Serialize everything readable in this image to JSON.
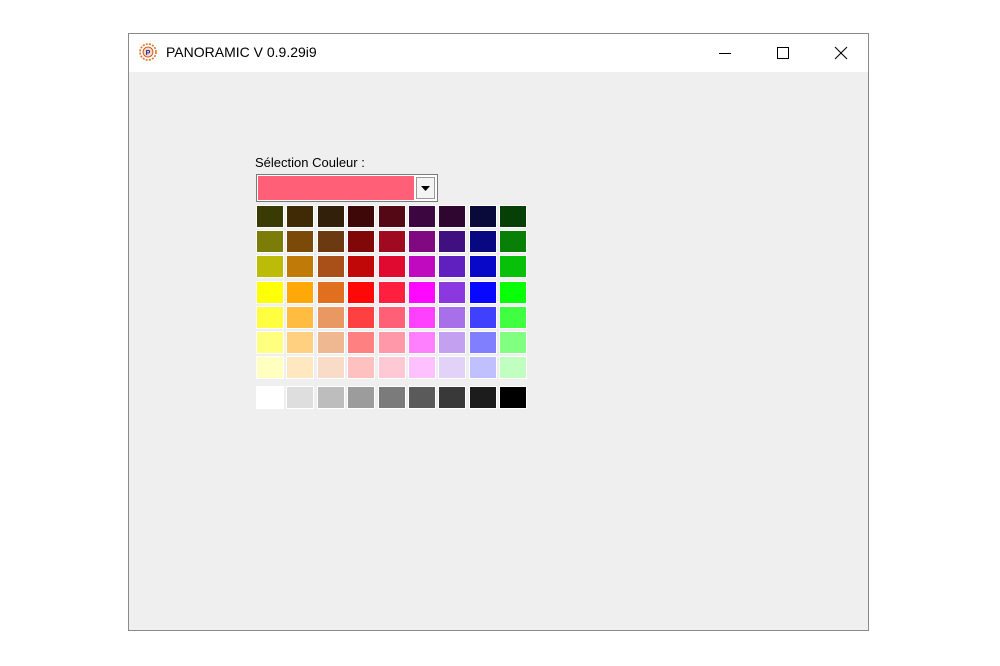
{
  "window": {
    "title": "PANORAMIC V 0.9.29i9",
    "icon": "panoramic-app-icon",
    "controls": [
      "minimize-icon",
      "maximize-icon",
      "close-icon"
    ]
  },
  "form": {
    "label": "Sélection Couleur :",
    "selected_color": "#ff6078",
    "dropdown_icon": "chevron-down-icon"
  },
  "palette": {
    "rows": [
      [
        "#3a3a05",
        "#3f2a05",
        "#33200a",
        "#3e0808",
        "#540816",
        "#3c0640",
        "#2e0630",
        "#0a0a3a",
        "#064006"
      ],
      [
        "#7c7c08",
        "#7c4a08",
        "#6b3a10",
        "#800808",
        "#a00a20",
        "#800880",
        "#401080",
        "#080880",
        "#088008"
      ],
      [
        "#bcbc08",
        "#c07a08",
        "#a85018",
        "#c00808",
        "#e00a30",
        "#c00ac0",
        "#6020c0",
        "#0808c8",
        "#08c008"
      ],
      [
        "#ffff08",
        "#ffa808",
        "#e07020",
        "#ff0808",
        "#ff2040",
        "#ff08ff",
        "#8c38e0",
        "#0808ff",
        "#08ff08"
      ],
      [
        "#ffff40",
        "#ffbc40",
        "#e89860",
        "#ff4040",
        "#ff6078",
        "#ff40ff",
        "#a870e8",
        "#4040ff",
        "#40ff40"
      ],
      [
        "#ffff80",
        "#ffd080",
        "#f0b890",
        "#ff8080",
        "#ff98a8",
        "#ff80ff",
        "#c4a0f0",
        "#8080ff",
        "#80ff80"
      ],
      [
        "#ffffc0",
        "#ffe8c0",
        "#f8dcc8",
        "#ffc0c0",
        "#ffc8d4",
        "#ffc0ff",
        "#e2d2f8",
        "#c0c0ff",
        "#c0ffc0"
      ],
      [
        "#ffffff",
        "#dedede",
        "#bdbdbd",
        "#9c9c9c",
        "#7b7b7b",
        "#5a5a5a",
        "#393939",
        "#1c1c1c",
        "#000000"
      ]
    ]
  }
}
